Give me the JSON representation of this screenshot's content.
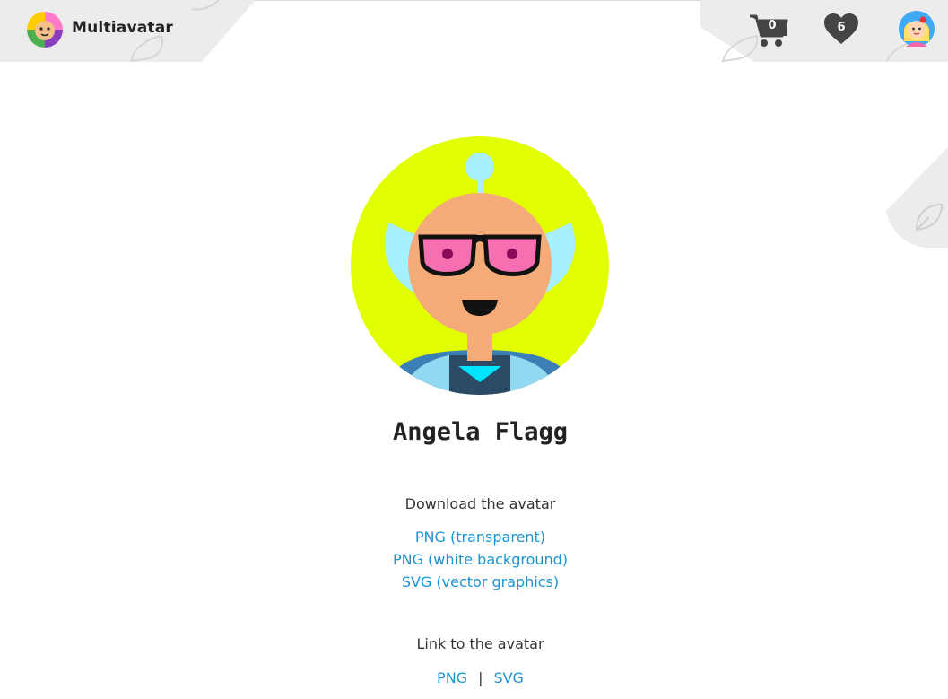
{
  "header": {
    "brand": "Multiavatar",
    "cart_count": "0",
    "favorites_count": "6",
    "icons": {
      "logo": "multiavatar-logo-icon",
      "cart": "cart-icon",
      "favorites": "heart-icon",
      "user": "user-avatar-icon"
    }
  },
  "avatar": {
    "name": "Angela Flagg",
    "colors": {
      "background": "#e1ff00",
      "skin": "#f4ab78",
      "glasses_lens": "#f66fb0",
      "hair": "#a6f0ff",
      "shirt": "#2b4a66",
      "collar": "#00e5ff"
    }
  },
  "download": {
    "title": "Download the avatar",
    "png_transparent": "PNG (transparent)",
    "png_white": "PNG (white background)",
    "svg": "SVG (vector graphics)"
  },
  "link_section": {
    "title": "Link to the avatar",
    "png": "PNG",
    "separator": "|",
    "svg": "SVG"
  },
  "colors": {
    "link": "#1a94d2",
    "panel": "#ececec",
    "icon": "#444444"
  }
}
